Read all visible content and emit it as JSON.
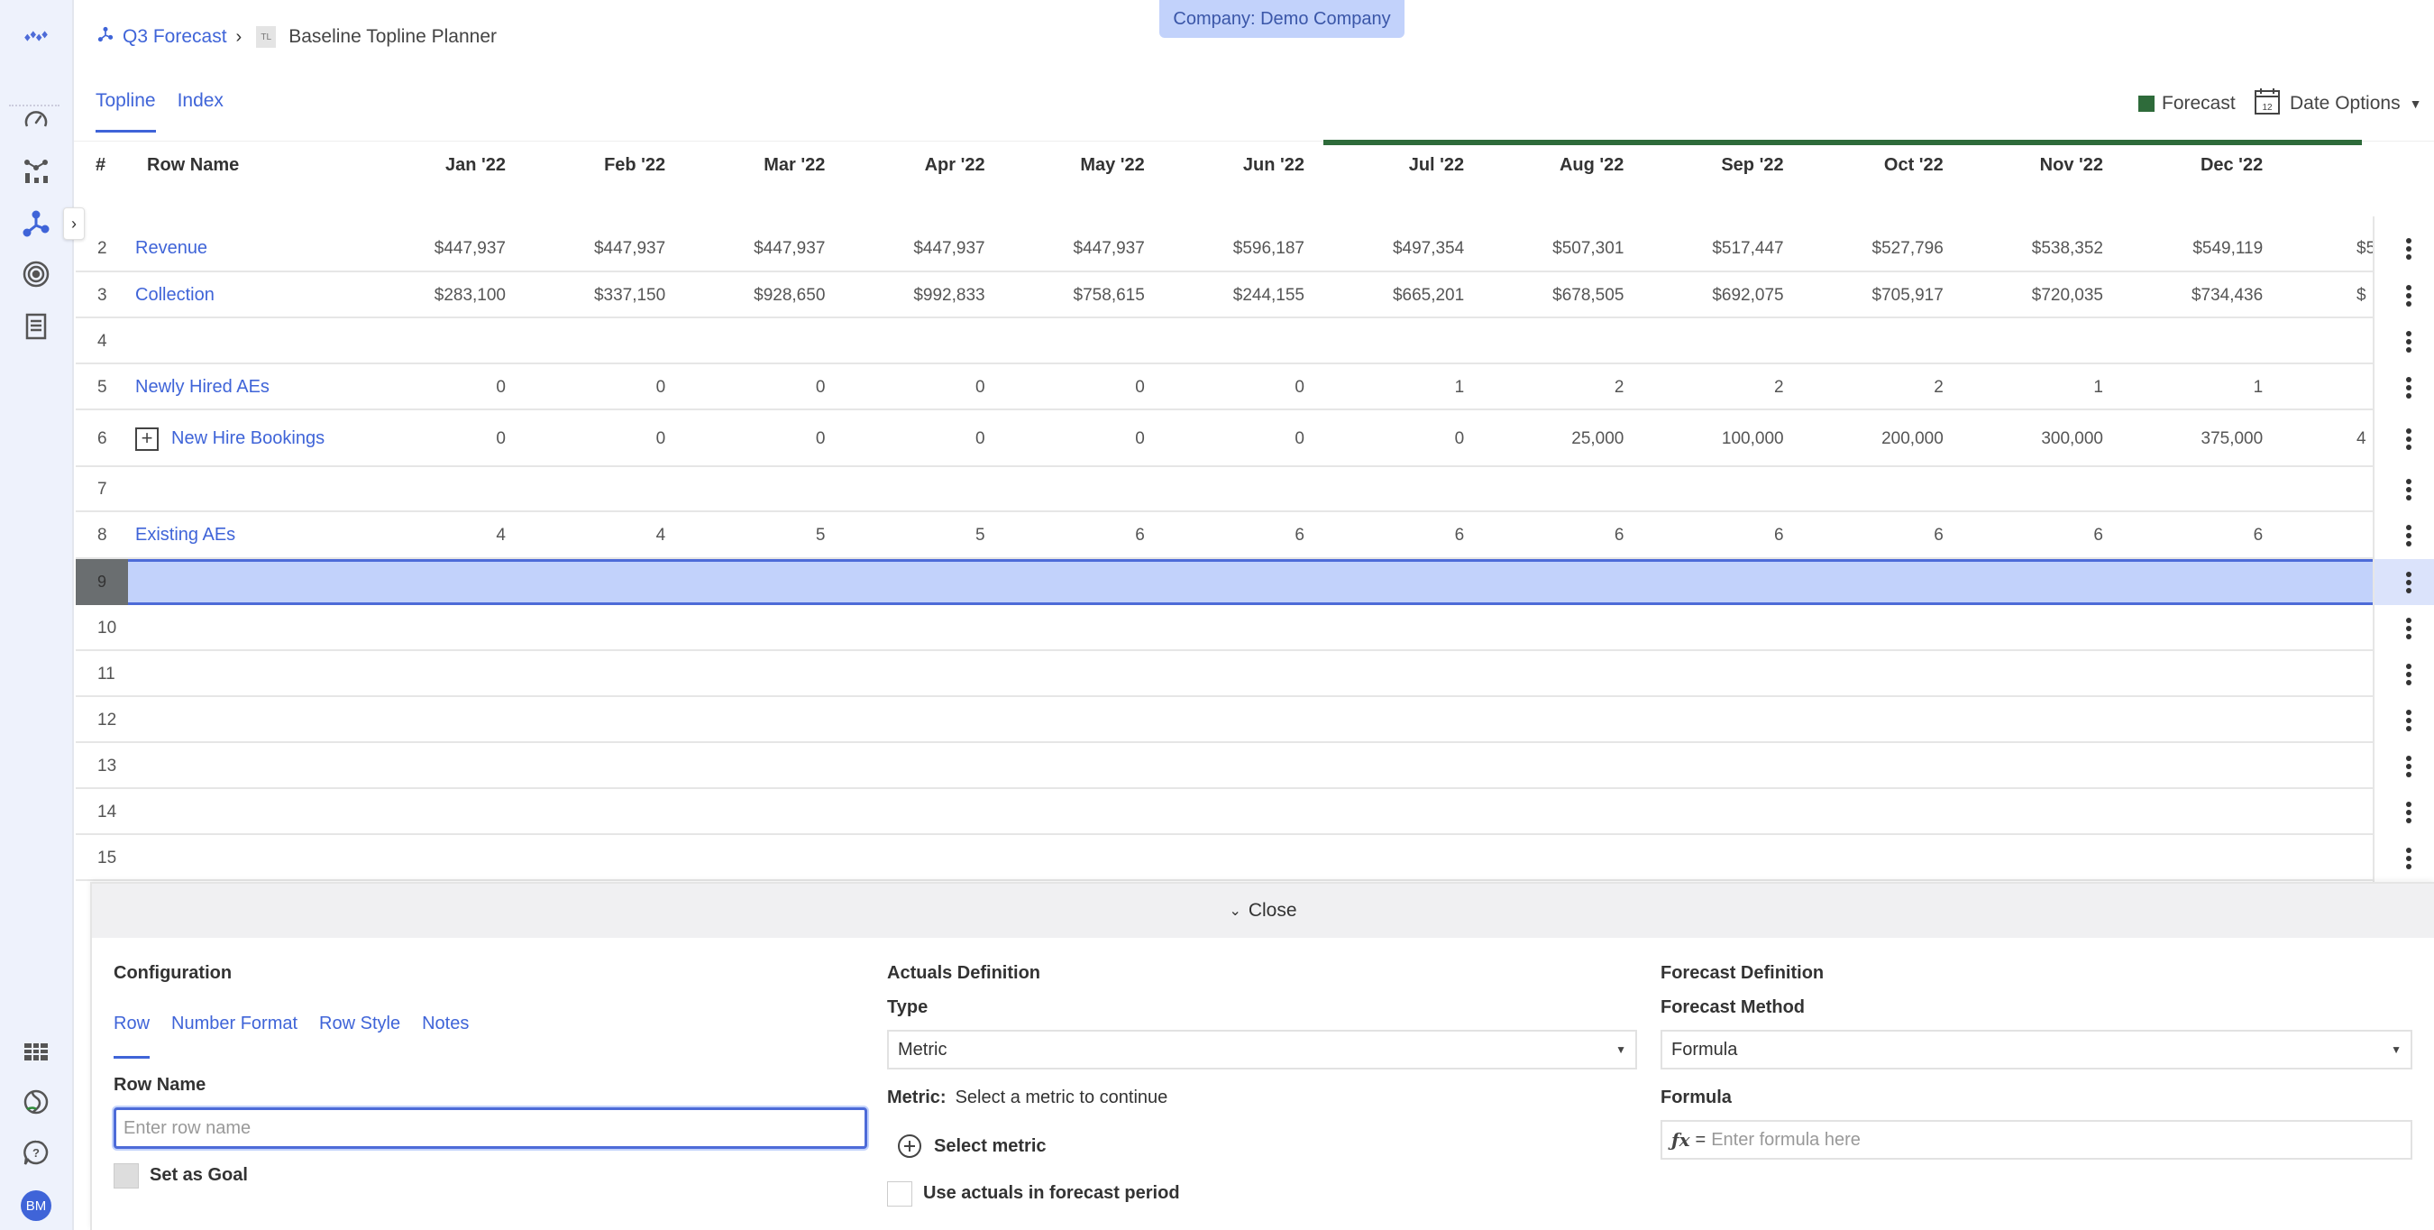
{
  "company_badge": "Company: Demo Company",
  "breadcrumb": {
    "parent": "Q3 Forecast",
    "badge": "TL",
    "current": "Baseline Topline Planner"
  },
  "tabs": [
    {
      "label": "Topline",
      "active": true
    },
    {
      "label": "Index",
      "active": false
    }
  ],
  "legend": {
    "forecast_label": "Forecast",
    "forecast_color": "#2e6b3a"
  },
  "date_options": {
    "label": "Date Options",
    "calendar_day": "12"
  },
  "sidebar": {
    "items": [
      "logo-icon",
      "dashboard-gauge-icon",
      "analytics-icon",
      "planning-icon",
      "goals-target-icon",
      "reports-document-icon"
    ],
    "bottom_items": [
      "table-grid-icon",
      "integrations-icon",
      "help-icon"
    ],
    "avatar_initials": "BM",
    "toggle": "›"
  },
  "grid": {
    "headers": {
      "num": "#",
      "name": "Row Name"
    },
    "months": [
      "Jan '22",
      "Feb '22",
      "Mar '22",
      "Apr '22",
      "May '22",
      "Jun '22",
      "Jul '22",
      "Aug '22",
      "Sep '22",
      "Oct '22",
      "Nov '22",
      "Dec '22"
    ],
    "rows": [
      {
        "num": "2",
        "name": "Revenue",
        "values": [
          "$447,937",
          "$447,937",
          "$447,937",
          "$447,937",
          "$447,937",
          "$596,187",
          "$497,354",
          "$507,301",
          "$517,447",
          "$527,796",
          "$538,352",
          "$549,119"
        ],
        "clipped": "$5"
      },
      {
        "num": "3",
        "name": "Collection",
        "values": [
          "$283,100",
          "$337,150",
          "$928,650",
          "$992,833",
          "$758,615",
          "$244,155",
          "$665,201",
          "$678,505",
          "$692,075",
          "$705,917",
          "$720,035",
          "$734,436"
        ],
        "clipped": "$"
      },
      {
        "num": "4",
        "name": "",
        "values": [],
        "clipped": ""
      },
      {
        "num": "5",
        "name": "Newly Hired AEs",
        "values": [
          "0",
          "0",
          "0",
          "0",
          "0",
          "0",
          "1",
          "2",
          "2",
          "2",
          "1",
          "1"
        ],
        "clipped": ""
      },
      {
        "num": "6",
        "name": "New Hire Bookings",
        "expandable": true,
        "values": [
          "0",
          "0",
          "0",
          "0",
          "0",
          "0",
          "0",
          "25,000",
          "100,000",
          "200,000",
          "300,000",
          "375,000"
        ],
        "clipped": "4"
      },
      {
        "num": "7",
        "name": "",
        "values": [],
        "clipped": ""
      },
      {
        "num": "8",
        "name": "Existing AEs",
        "values": [
          "4",
          "4",
          "5",
          "5",
          "6",
          "6",
          "6",
          "6",
          "6",
          "6",
          "6",
          "6"
        ],
        "clipped": ""
      },
      {
        "num": "9",
        "name": "",
        "values": [],
        "clipped": "",
        "selected": true
      },
      {
        "num": "10",
        "name": "",
        "values": [],
        "clipped": ""
      },
      {
        "num": "11",
        "name": "",
        "values": [],
        "clipped": ""
      },
      {
        "num": "12",
        "name": "",
        "values": [],
        "clipped": ""
      },
      {
        "num": "13",
        "name": "",
        "values": [],
        "clipped": ""
      },
      {
        "num": "14",
        "name": "",
        "values": [],
        "clipped": ""
      },
      {
        "num": "15",
        "name": "",
        "values": [],
        "clipped": ""
      }
    ]
  },
  "panel": {
    "close_label": "Close",
    "configuration": {
      "title": "Configuration",
      "tabs": [
        "Row",
        "Number Format",
        "Row Style",
        "Notes"
      ],
      "active_tab": "Row",
      "row_name_label": "Row Name",
      "row_name_value": "",
      "row_name_placeholder": "Enter row name",
      "set_as_goal_label": "Set as Goal",
      "set_as_goal_checked": false
    },
    "actuals": {
      "title": "Actuals Definition",
      "type_label": "Type",
      "type_value": "Metric",
      "metric_label": "Metric:",
      "metric_value": "Select a metric to continue",
      "select_metric_label": "Select metric",
      "use_actuals_label": "Use actuals in forecast period",
      "use_actuals_checked": false
    },
    "forecast": {
      "title": "Forecast Definition",
      "method_label": "Forecast Method",
      "method_value": "Formula",
      "formula_label": "Formula",
      "formula_prefix": "ƒx",
      "formula_eq": "=",
      "formula_placeholder": "Enter formula here"
    }
  }
}
